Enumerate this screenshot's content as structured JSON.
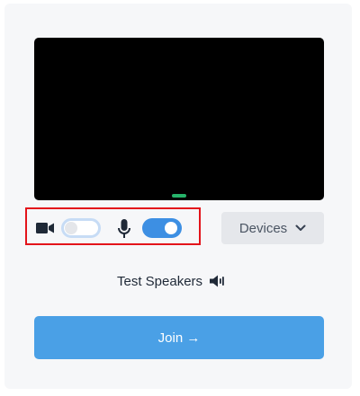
{
  "preview": {
    "camera_enabled": false,
    "microphone_enabled": true
  },
  "devices_button": {
    "label": "Devices"
  },
  "test_speakers": {
    "label": "Test Speakers",
    "icon": "speaker-icon"
  },
  "join_button": {
    "label": "Join →"
  },
  "icons": {
    "camera": "camera-icon",
    "microphone": "microphone-icon",
    "chevron": "chevron-down-icon"
  },
  "colors": {
    "video_bg": "#000000",
    "mic_level": "#26b36a",
    "toggle_on": "#3d8fe3",
    "join": "#4aa0e6",
    "highlight": "#e3141b"
  }
}
